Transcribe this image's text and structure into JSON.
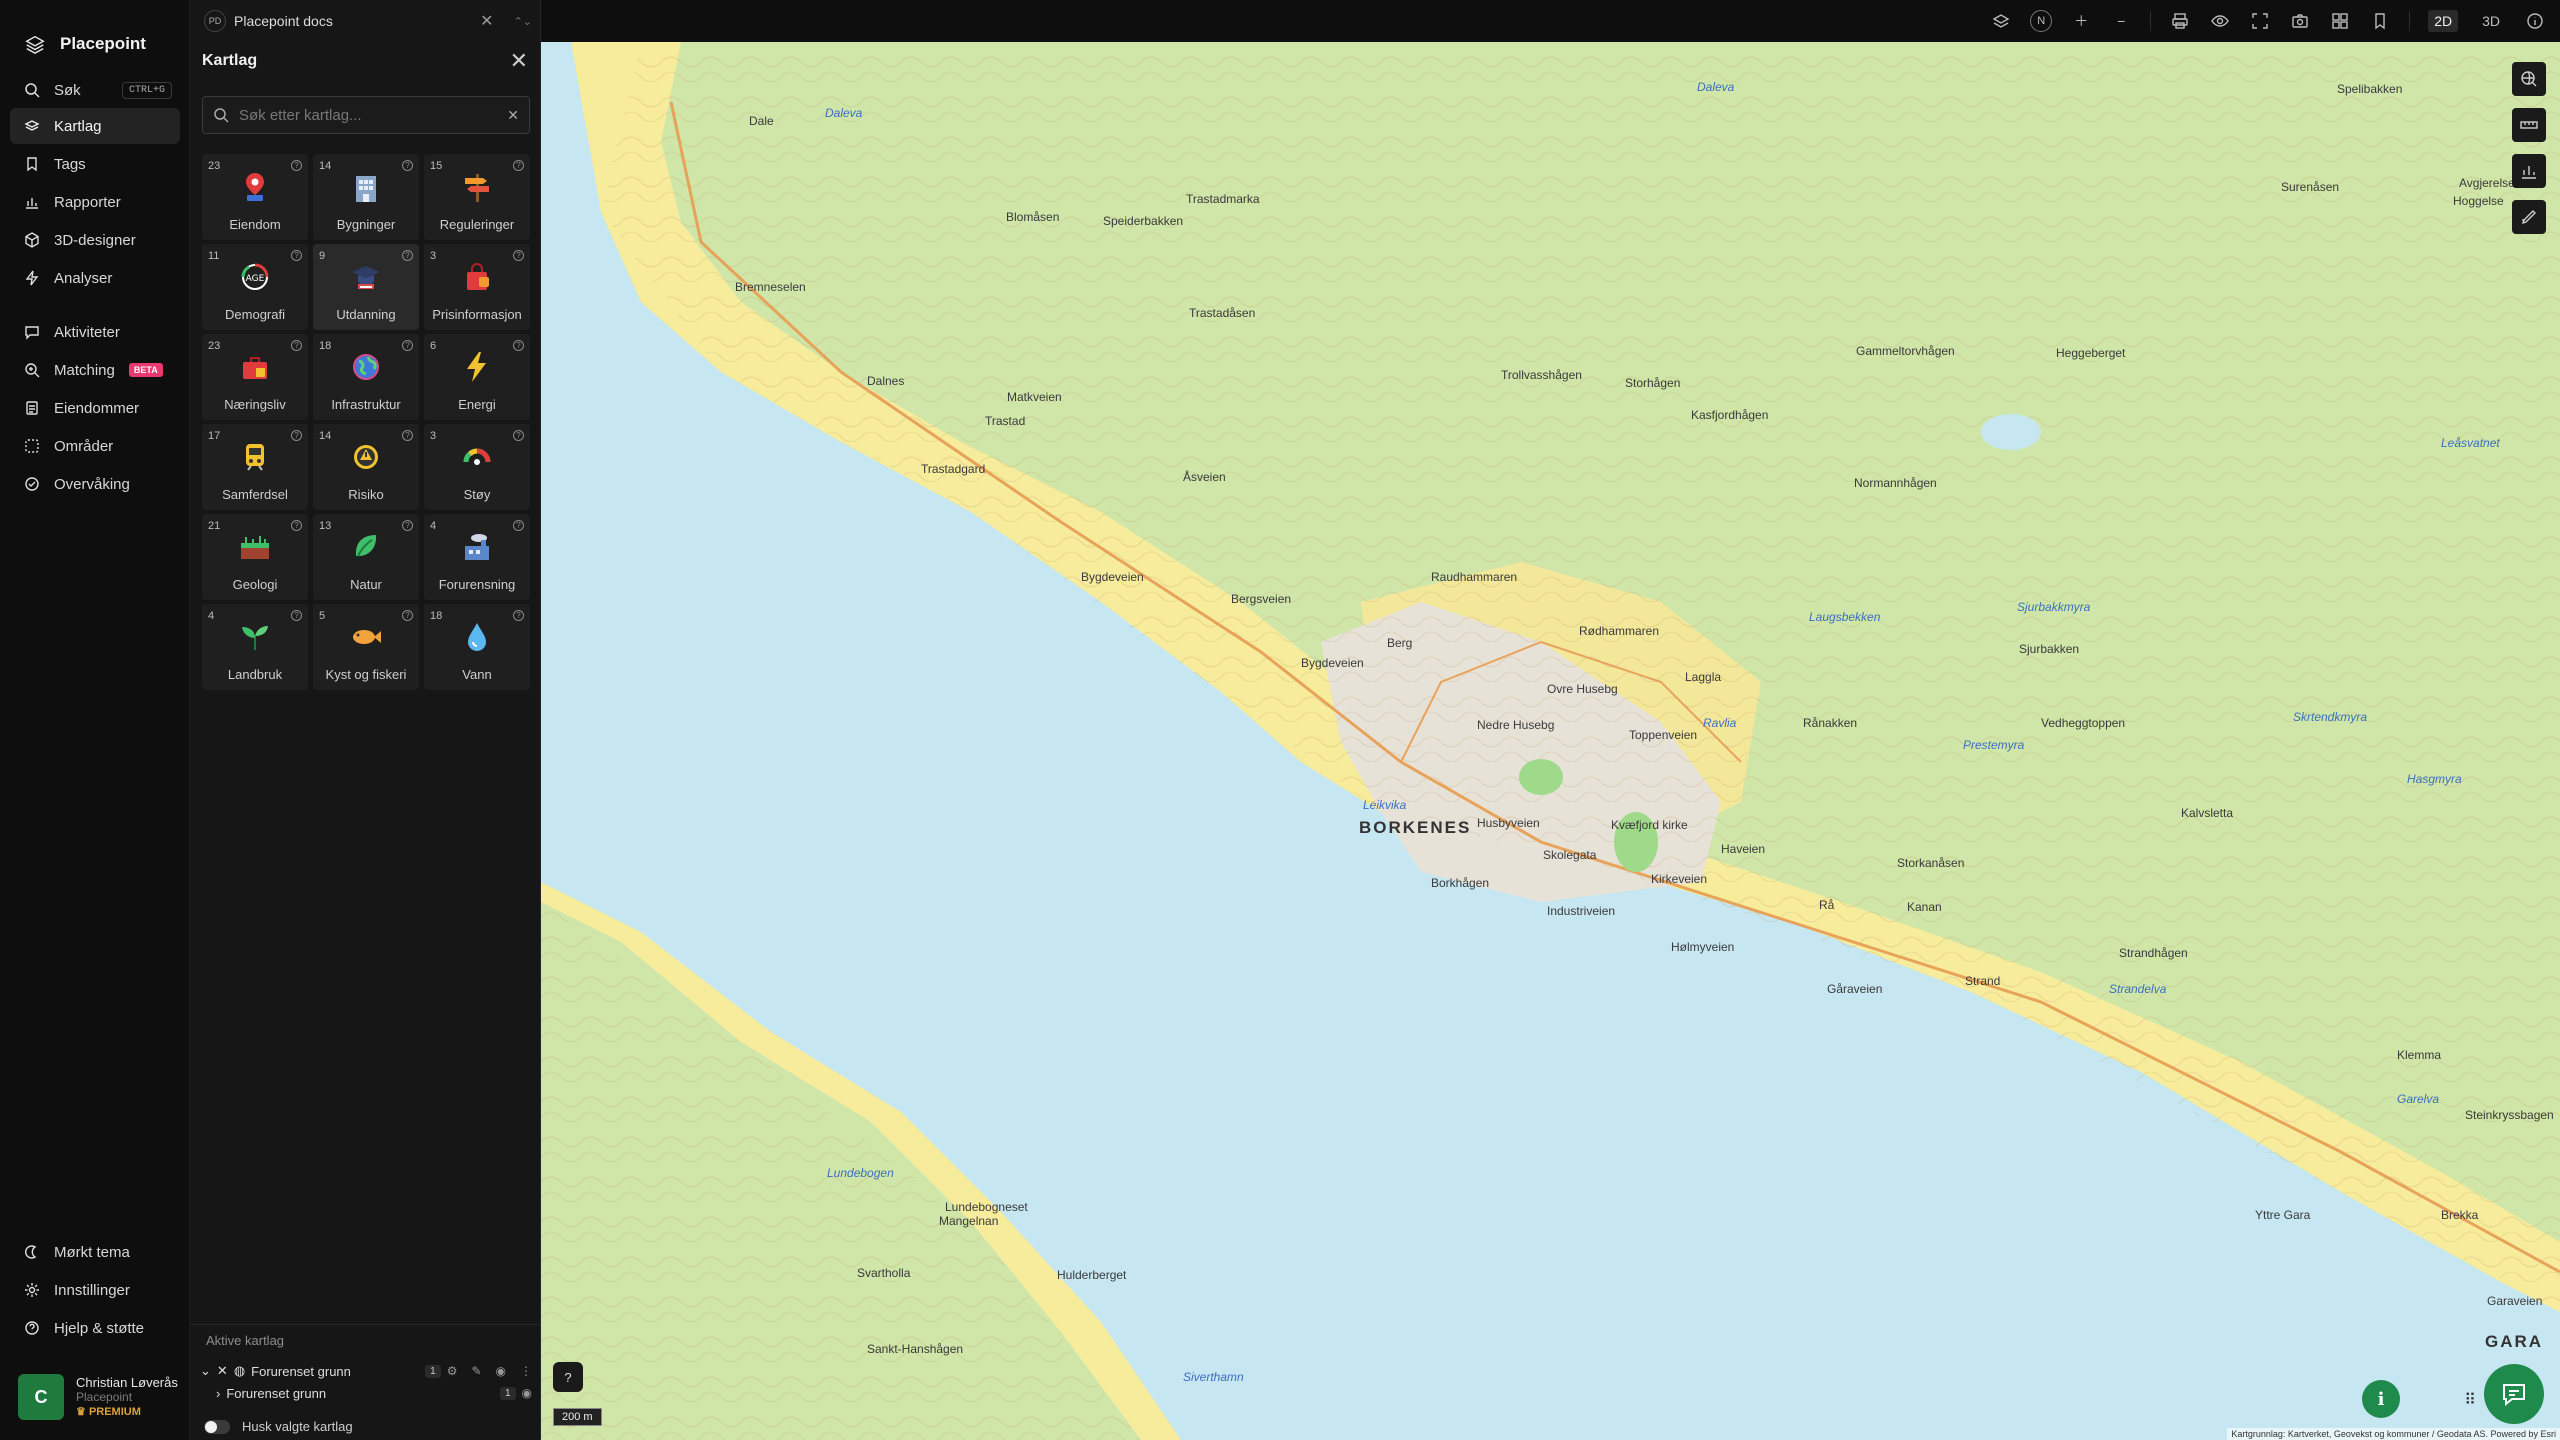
{
  "app": {
    "name": "Placepoint"
  },
  "nav": {
    "items": [
      {
        "label": "Søk",
        "shortcut": "CTRL+G"
      },
      {
        "label": "Kartlag"
      },
      {
        "label": "Tags"
      },
      {
        "label": "Rapporter"
      },
      {
        "label": "3D-designer"
      },
      {
        "label": "Analyser"
      },
      {
        "label": "Aktiviteter"
      },
      {
        "label": "Matching",
        "badge": "BETA"
      },
      {
        "label": "Eiendommer"
      },
      {
        "label": "Områder"
      },
      {
        "label": "Overvåking"
      }
    ],
    "bottom": [
      {
        "label": "Mørkt tema"
      },
      {
        "label": "Innstillinger"
      },
      {
        "label": "Hjelp & støtte"
      }
    ],
    "user": {
      "initial": "C",
      "name": "Christian Løverås",
      "org": "Placepoint",
      "plan": "PREMIUM"
    }
  },
  "doc_tab": {
    "badge": "PD",
    "title": "Placepoint docs"
  },
  "panel": {
    "title": "Kartlag",
    "search_placeholder": "Søk etter kartlag...",
    "categories": [
      {
        "count": "23",
        "label": "Eiendom",
        "icon": "pin-house-icon"
      },
      {
        "count": "14",
        "label": "Bygninger",
        "icon": "building-icon"
      },
      {
        "count": "15",
        "label": "Reguleringer",
        "icon": "signpost-icon"
      },
      {
        "count": "11",
        "label": "Demografi",
        "icon": "age-icon"
      },
      {
        "count": "9",
        "label": "Utdanning",
        "icon": "graduation-cap-icon"
      },
      {
        "count": "3",
        "label": "Prisinformasjon",
        "icon": "shopping-bag-icon"
      },
      {
        "count": "23",
        "label": "Næringsliv",
        "icon": "briefcase-icon"
      },
      {
        "count": "18",
        "label": "Infrastruktur",
        "icon": "globe-icon"
      },
      {
        "count": "6",
        "label": "Energi",
        "icon": "lightning-icon"
      },
      {
        "count": "17",
        "label": "Samferdsel",
        "icon": "train-icon"
      },
      {
        "count": "14",
        "label": "Risiko",
        "icon": "hazard-icon"
      },
      {
        "count": "3",
        "label": "Støy",
        "icon": "noise-gauge-icon"
      },
      {
        "count": "21",
        "label": "Geologi",
        "icon": "soil-layers-icon"
      },
      {
        "count": "13",
        "label": "Natur",
        "icon": "leaf-icon"
      },
      {
        "count": "4",
        "label": "Forurensning",
        "icon": "factory-icon"
      },
      {
        "count": "4",
        "label": "Landbruk",
        "icon": "sprout-icon"
      },
      {
        "count": "5",
        "label": "Kyst og fiskeri",
        "icon": "fish-icon"
      },
      {
        "count": "18",
        "label": "Vann",
        "icon": "water-drop-icon"
      }
    ],
    "active_layers": {
      "header": "Aktive kartlag",
      "group": {
        "label": "Forurenset grunn",
        "count": "1"
      },
      "child": {
        "label": "Forurenset grunn",
        "count": "1"
      }
    },
    "remember_label": "Husk valgte kartlag"
  },
  "toolbar": {
    "north": "N",
    "mode_2d": "2D",
    "mode_3d": "3D"
  },
  "map": {
    "labels": [
      "Dale",
      "Daleva",
      "Daleva",
      "Spelibakken",
      "Surenåsen",
      "Avgjerelsens",
      "Hoggelse",
      "Trastadmarka",
      "Blomåsen",
      "Speiderbakken",
      "Trastadåsen",
      "Bremneselen",
      "Dalnes",
      "Matkveien",
      "Trastad",
      "Trastadgard",
      "Åsveien",
      "Trollvasshågen",
      "Storhågen",
      "Kasfjordhågen",
      "Gammeltorvhågen",
      "Heggeberget",
      "Normannhågen",
      "Leåsvatnet",
      "Bygdeveien",
      "Bergsveien",
      "Raudhammaren",
      "Rødhammaren",
      "Laugsbekken",
      "Sjurbakkmyra",
      "Sjurbakken",
      "Berg",
      "Bygdeveien",
      "Laggla",
      "Ovre Husebg",
      "Nedre Husebg",
      "Toppenveien",
      "Ravlia",
      "Rånakken",
      "Vedheggtoppen",
      "Skrtendkmyra",
      "Prestemyra",
      "Hasgmyra",
      "Leikvika",
      "BORKENES",
      "Husbyveien",
      "Kvæfjord kirke",
      "Kalvsletta",
      "Borkhågen",
      "Skolegata",
      "Industriveien",
      "Kirkeveien",
      "Hølmyveien",
      "Haveien",
      "Rå",
      "Kanan",
      "Storkanåsen",
      "Strandhågen",
      "Strand",
      "Gåraveien",
      "Strandelva",
      "Klemma",
      "Steinkryssbagen",
      "Garelva",
      "Lundebogen",
      "Lundebogneset",
      "Mangelnan",
      "Hulderberget",
      "Svartholla",
      "Sankt-Hanshågen",
      "Siverthamn",
      "Yttre Gara",
      "Brekka",
      "Garaveien",
      "GARA"
    ],
    "scale": "200 m",
    "attribution": "Kartgrunnlag: Kartverket, Geovekst og kommuner / Geodata AS. Powered by Esri"
  },
  "colors": {
    "accent": "#1e8a4c",
    "beta_badge": "#e83a6e",
    "water": "#c6e6f1",
    "forest": "#cfe6a8",
    "farmland": "#f6ec9c"
  }
}
